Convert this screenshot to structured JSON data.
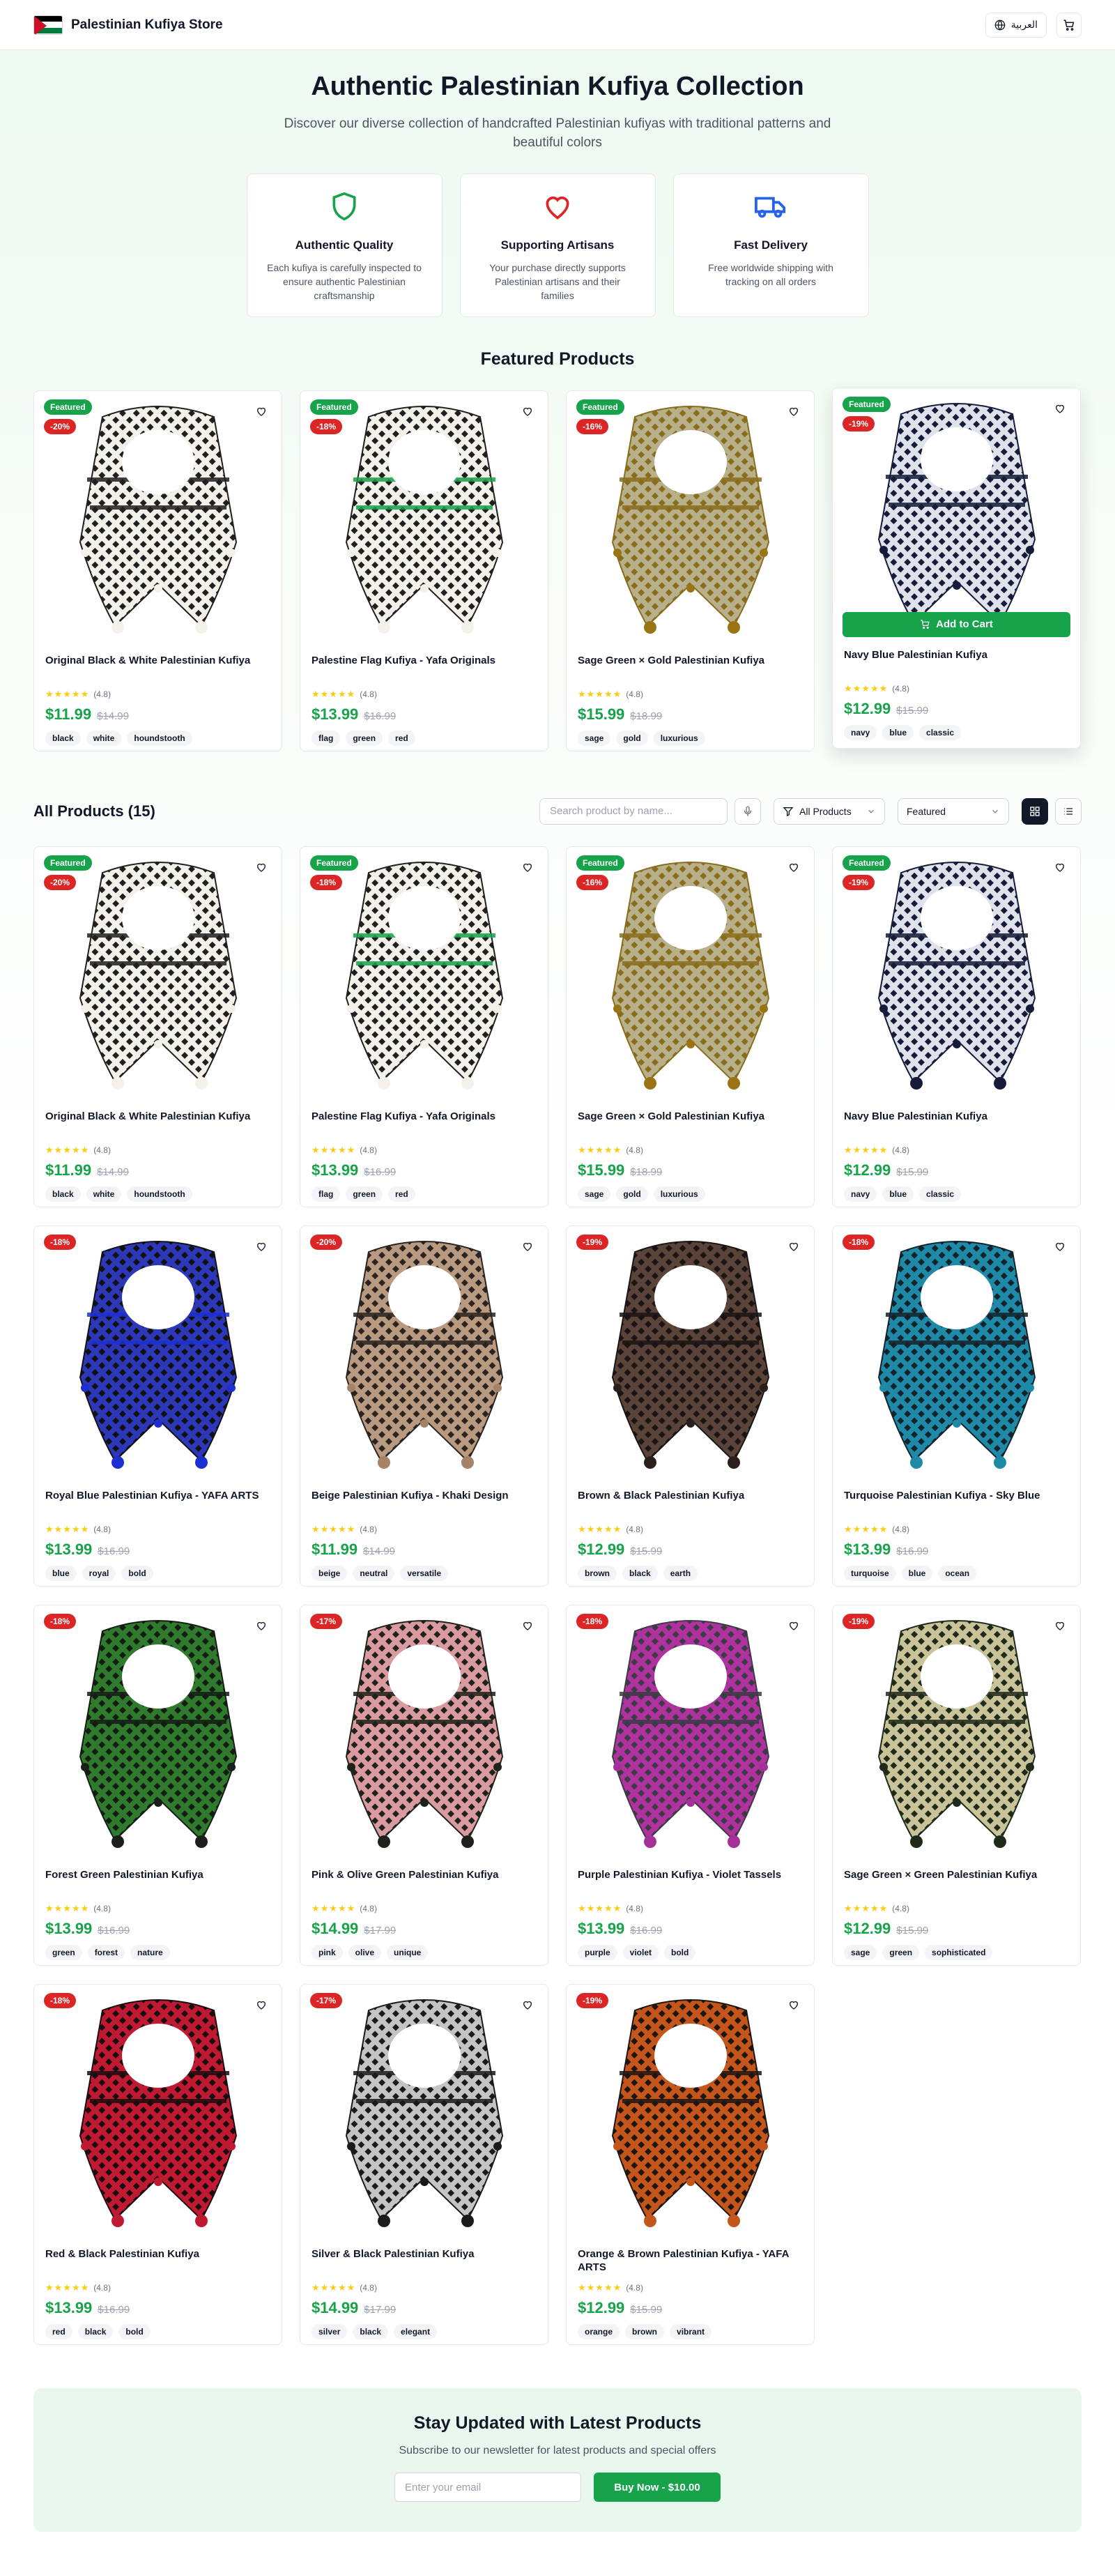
{
  "header": {
    "brand_name": "Palestinian Kufiya Store",
    "language_label": "العربية",
    "flag_colors": [
      "#000000",
      "#ffffff",
      "#007a3d",
      "#ce1126"
    ]
  },
  "hero": {
    "title": "Authentic Palestinian Kufiya Collection",
    "subtitle": "Discover our diverse collection of handcrafted Palestinian kufiyas with traditional patterns and beautiful colors"
  },
  "features": [
    {
      "icon": "shield-icon",
      "title": "Authentic Quality",
      "text": "Each kufiya is carefully inspected to ensure authentic Palestinian craftsmanship",
      "color": "#16a34a"
    },
    {
      "icon": "heart-icon",
      "title": "Supporting Artisans",
      "text": "Your purchase directly supports Palestinian artisans and their families",
      "color": "#dc2626"
    },
    {
      "icon": "truck-icon",
      "title": "Fast Delivery",
      "text": "Free worldwide shipping with tracking on all orders",
      "color": "#2563eb"
    }
  ],
  "featured": {
    "title": "Featured Products",
    "add_to_cart_label": "Add to Cart"
  },
  "all_products": {
    "title": "All Products (15)",
    "search_placeholder": "Search product by name...",
    "filter_label": "All Products",
    "sort_label": "Featured"
  },
  "labels": {
    "featured_badge": "Featured",
    "rating": "(4.8)",
    "stars": "★★★★★"
  },
  "products": [
    {
      "name": "Original Black & White Palestinian Kufiya",
      "discount": "-20%",
      "price": "$11.99",
      "old_price": "$14.99",
      "tags": [
        "black",
        "white",
        "houndstooth"
      ],
      "featured": true,
      "base": "#f4f1ea",
      "pattern": "#1f1f1f",
      "accent": "#1f1f1f",
      "tassel": "#f4f1ea"
    },
    {
      "name": "Palestine Flag Kufiya - Yafa Originals",
      "discount": "-18%",
      "price": "$13.99",
      "old_price": "$16.99",
      "tags": [
        "flag",
        "green",
        "red"
      ],
      "featured": true,
      "base": "#f4f1ea",
      "pattern": "#1f1f1f",
      "accent": "#16a34a",
      "tassel": "#f4f1ea"
    },
    {
      "name": "Sage Green × Gold Palestinian Kufiya",
      "discount": "-16%",
      "price": "$15.99",
      "old_price": "$18.99",
      "tags": [
        "sage",
        "gold",
        "luxurious"
      ],
      "featured": true,
      "base": "#b7b08a",
      "pattern": "#8a6d1c",
      "accent": "#8a6d1c",
      "tassel": "#9a7414"
    },
    {
      "name": "Navy Blue Palestinian Kufiya",
      "discount": "-19%",
      "price": "$12.99",
      "old_price": "$15.99",
      "tags": [
        "navy",
        "blue",
        "classic"
      ],
      "featured": true,
      "base": "#dfe2ea",
      "pattern": "#151b38",
      "accent": "#151b38",
      "tassel": "#151b38"
    },
    {
      "name": "Royal Blue Palestinian Kufiya - YAFA ARTS",
      "discount": "-18%",
      "price": "$13.99",
      "old_price": "$16.99",
      "tags": [
        "blue",
        "royal",
        "bold"
      ],
      "featured": false,
      "base": "#2c38b8",
      "pattern": "#111111",
      "accent": "#1d2fd0",
      "tassel": "#1d2fd0"
    },
    {
      "name": "Beige Palestinian Kufiya - Khaki Design",
      "discount": "-20%",
      "price": "$11.99",
      "old_price": "$14.99",
      "tags": [
        "beige",
        "neutral",
        "versatile"
      ],
      "featured": false,
      "base": "#b89a80",
      "pattern": "#2a2320",
      "accent": "#2a2320",
      "tassel": "#a68267"
    },
    {
      "name": "Brown & Black Palestinian Kufiya",
      "discount": "-19%",
      "price": "$12.99",
      "old_price": "$15.99",
      "tags": [
        "brown",
        "black",
        "earth"
      ],
      "featured": false,
      "base": "#5a4338",
      "pattern": "#1a1414",
      "accent": "#1a1414",
      "tassel": "#2b1f1b"
    },
    {
      "name": "Turquoise Palestinian Kufiya - Sky Blue",
      "discount": "-18%",
      "price": "$13.99",
      "old_price": "$16.99",
      "tags": [
        "turquoise",
        "blue",
        "ocean"
      ],
      "featured": false,
      "base": "#1f8aa8",
      "pattern": "#14232b",
      "accent": "#14232b",
      "tassel": "#1f8aa8"
    },
    {
      "name": "Forest Green Palestinian Kufiya",
      "discount": "-18%",
      "price": "$13.99",
      "old_price": "$16.99",
      "tags": [
        "green",
        "forest",
        "nature"
      ],
      "featured": false,
      "base": "#2f7a2c",
      "pattern": "#141d14",
      "accent": "#141d14",
      "tassel": "#1a1f1a"
    },
    {
      "name": "Pink & Olive Green Palestinian Kufiya",
      "discount": "-17%",
      "price": "$14.99",
      "old_price": "$17.99",
      "tags": [
        "pink",
        "olive",
        "unique"
      ],
      "featured": false,
      "base": "#d99aa0",
      "pattern": "#1e221a",
      "accent": "#1e221a",
      "tassel": "#1e221a"
    },
    {
      "name": "Purple Palestinian Kufiya - Violet Tassels",
      "discount": "-18%",
      "price": "$13.99",
      "old_price": "$16.99",
      "tags": [
        "purple",
        "violet",
        "bold"
      ],
      "featured": false,
      "base": "#b0329f",
      "pattern": "#3a3b45",
      "accent": "#3a3b45",
      "tassel": "#a4309a"
    },
    {
      "name": "Sage Green × Green Palestinian Kufiya",
      "discount": "-19%",
      "price": "$12.99",
      "old_price": "$15.99",
      "tags": [
        "sage",
        "green",
        "sophisticated"
      ],
      "featured": false,
      "base": "#c9c39a",
      "pattern": "#1f2a1a",
      "accent": "#1f2a1a",
      "tassel": "#1f2a1a"
    },
    {
      "name": "Red & Black Palestinian Kufiya",
      "discount": "-18%",
      "price": "$13.99",
      "old_price": "$16.99",
      "tags": [
        "red",
        "black",
        "bold"
      ],
      "featured": false,
      "base": "#c01a33",
      "pattern": "#1a0d10",
      "accent": "#1a0d10",
      "tassel": "#c01a33"
    },
    {
      "name": "Silver & Black Palestinian Kufiya",
      "discount": "-17%",
      "price": "$14.99",
      "old_price": "$17.99",
      "tags": [
        "silver",
        "black",
        "elegant"
      ],
      "featured": false,
      "base": "#c4c4c4",
      "pattern": "#1a1a1a",
      "accent": "#1a1a1a",
      "tassel": "#1a1a1a"
    },
    {
      "name": "Orange & Brown Palestinian Kufiya - YAFA ARTS",
      "discount": "-19%",
      "price": "$12.99",
      "old_price": "$15.99",
      "tags": [
        "orange",
        "brown",
        "vibrant"
      ],
      "featured": false,
      "base": "#c4561c",
      "pattern": "#1e1612",
      "accent": "#1e1612",
      "tassel": "#c4561c"
    }
  ],
  "newsletter": {
    "title": "Stay Updated with Latest Products",
    "subtitle": "Subscribe to our newsletter for latest products and special offers",
    "email_placeholder": "Enter your email",
    "button_label": "Buy Now - $10.00"
  }
}
